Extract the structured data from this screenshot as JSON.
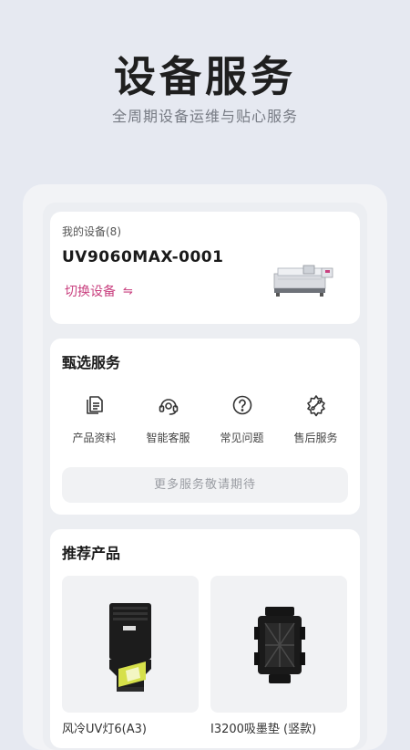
{
  "header": {
    "title": "设备服务",
    "subtitle": "全周期设备运维与贴心服务"
  },
  "my_device": {
    "count_label": "我的设备(8)",
    "device_name": "UV9060MAX-0001",
    "switch_label": "切换设备",
    "switch_icon": "⇋"
  },
  "services": {
    "title": "甄选服务",
    "items": [
      {
        "label": "产品资料",
        "icon": "document-icon"
      },
      {
        "label": "智能客服",
        "icon": "headset-icon"
      },
      {
        "label": "常见问题",
        "icon": "question-icon"
      },
      {
        "label": "售后服务",
        "icon": "wrench-gear-icon"
      }
    ],
    "more_label": "更多服务敬请期待"
  },
  "products": {
    "title": "推荐产品",
    "items": [
      {
        "name": "风冷UV灯6(A3)"
      },
      {
        "name": "I3200吸墨垫 (竖款)"
      }
    ]
  },
  "colors": {
    "accent": "#c9407f",
    "background": "#e6e9f1"
  }
}
